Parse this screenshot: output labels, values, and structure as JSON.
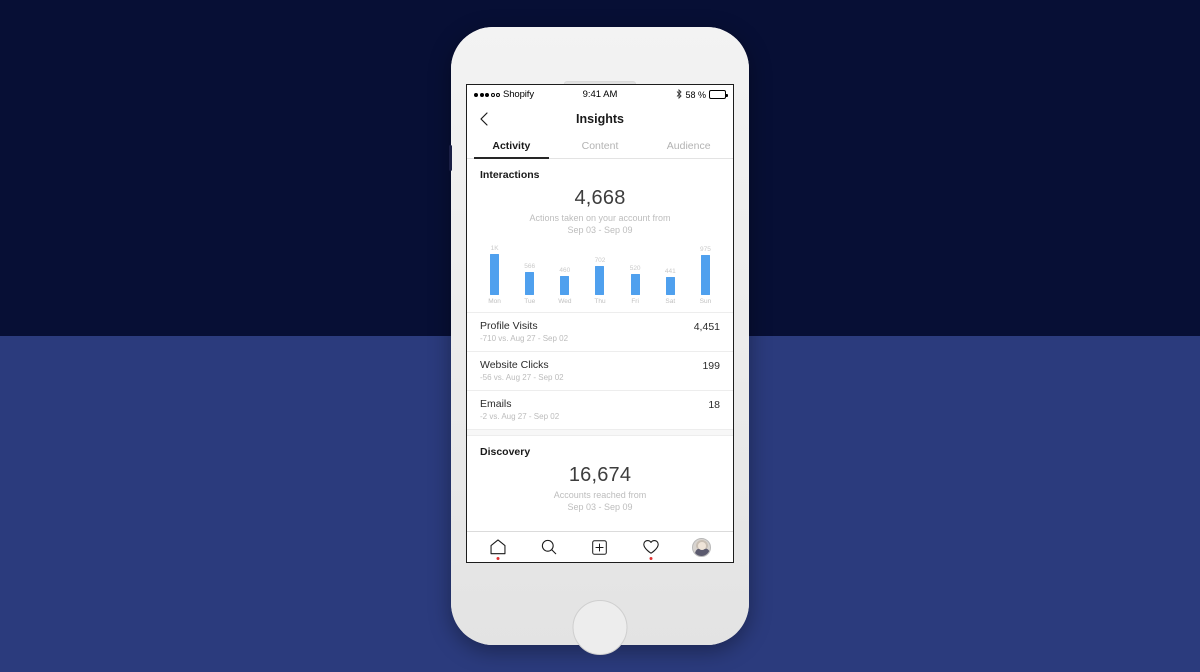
{
  "background": {
    "top_color": "#070f35",
    "bottom_color": "#2b3b7d"
  },
  "device": {
    "body_color": "#eeeeee",
    "name": "iphone-mockup"
  },
  "status_bar": {
    "carrier": "Shopify",
    "signal_dots_filled": 3,
    "signal_dots_empty": 2,
    "time": "9:41 AM",
    "bluetooth_icon": "bluetooth-icon",
    "battery_percent_label": "58 %",
    "battery_level": 58
  },
  "nav": {
    "back_icon": "chevron-left-icon",
    "title": "Insights"
  },
  "tabs": [
    {
      "label": "Activity",
      "active": true
    },
    {
      "label": "Content",
      "active": false
    },
    {
      "label": "Audience",
      "active": false
    }
  ],
  "interactions": {
    "heading": "Interactions",
    "value": "4,668",
    "caption_line1": "Actions taken on your account from",
    "caption_line2": "Sep 03 - Sep 09"
  },
  "chart_data": {
    "type": "bar",
    "title": "Interactions",
    "categories": [
      "Mon",
      "Tue",
      "Wed",
      "Thu",
      "Fri",
      "Sat",
      "Sun"
    ],
    "values": [
      1000,
      566,
      460,
      702,
      520,
      441,
      975
    ],
    "value_labels": [
      "1K",
      "566",
      "460",
      "702",
      "520",
      "441",
      "975"
    ],
    "xlabel": "",
    "ylabel": "",
    "ylim": [
      0,
      1000
    ],
    "grid": false,
    "legend": false,
    "bar_color": "#4fa0ee",
    "label_color": "#c9c9c9"
  },
  "metrics": [
    {
      "name": "Profile Visits",
      "sub": "-710 vs. Aug 27 - Sep 02",
      "value": "4,451"
    },
    {
      "name": "Website Clicks",
      "sub": "-56 vs. Aug 27 - Sep 02",
      "value": "199"
    },
    {
      "name": "Emails",
      "sub": "-2 vs. Aug 27 - Sep 02",
      "value": "18"
    }
  ],
  "discovery": {
    "heading": "Discovery",
    "value": "16,674",
    "caption_line1": "Accounts reached from",
    "caption_line2": "Sep 03 - Sep 09"
  },
  "tabbar": [
    {
      "icon": "home-icon",
      "badge": true
    },
    {
      "icon": "search-icon",
      "badge": false
    },
    {
      "icon": "add-post-icon",
      "badge": false
    },
    {
      "icon": "heart-icon",
      "badge": true
    },
    {
      "icon": "profile-avatar",
      "badge": false
    }
  ]
}
